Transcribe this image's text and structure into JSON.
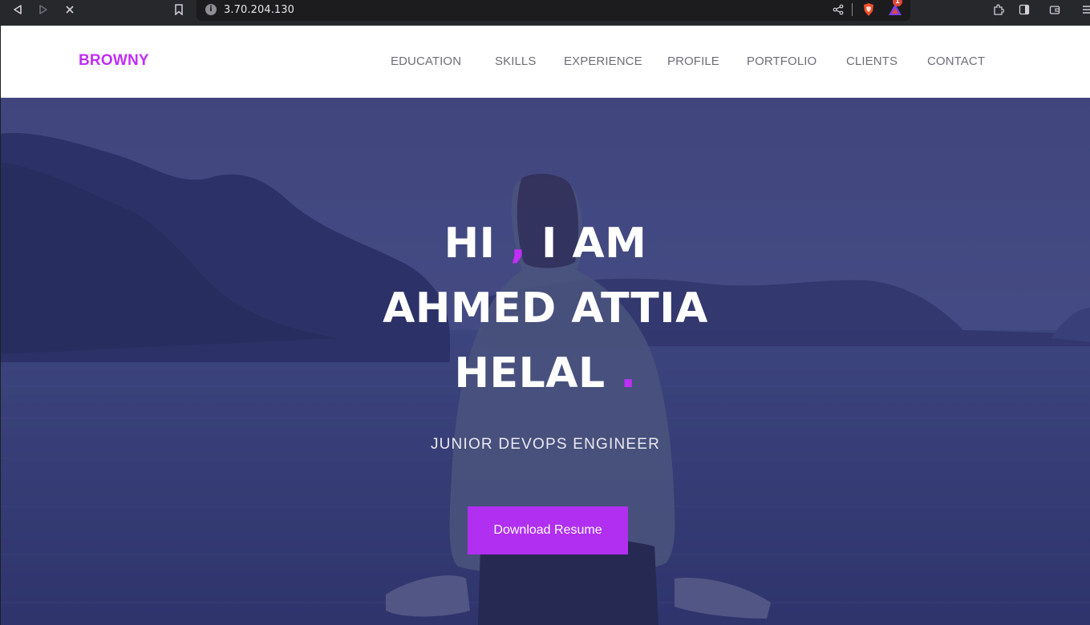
{
  "browser": {
    "url": "3.70.204.130",
    "info_icon": "info-icon",
    "notification_count": "1",
    "icons": [
      "back-icon",
      "forward-icon",
      "close-icon",
      "bookmark-icon",
      "share-icon",
      "brave-shield-icon",
      "brave-rewards-icon",
      "extensions-icon",
      "sidebar-icon",
      "wallet-icon",
      "menu-icon"
    ]
  },
  "site": {
    "brand": "BROWNY",
    "brand_color": "#c12ef7",
    "nav": [
      "EDUCATION",
      "SKILLS",
      "EXPERIENCE",
      "PROFILE",
      "PORTFOLIO",
      "CLIENTS",
      "CONTACT"
    ]
  },
  "hero": {
    "line1_a": "HI",
    "line1_comma": ",",
    "line1_b": "I AM",
    "line2": "AHMED ATTIA",
    "line3": "HELAL",
    "line3_dot": ".",
    "subtitle": "JUNIOR DEVOPS ENGINEER",
    "button": "Download Resume",
    "button_color": "#b02ff0"
  }
}
